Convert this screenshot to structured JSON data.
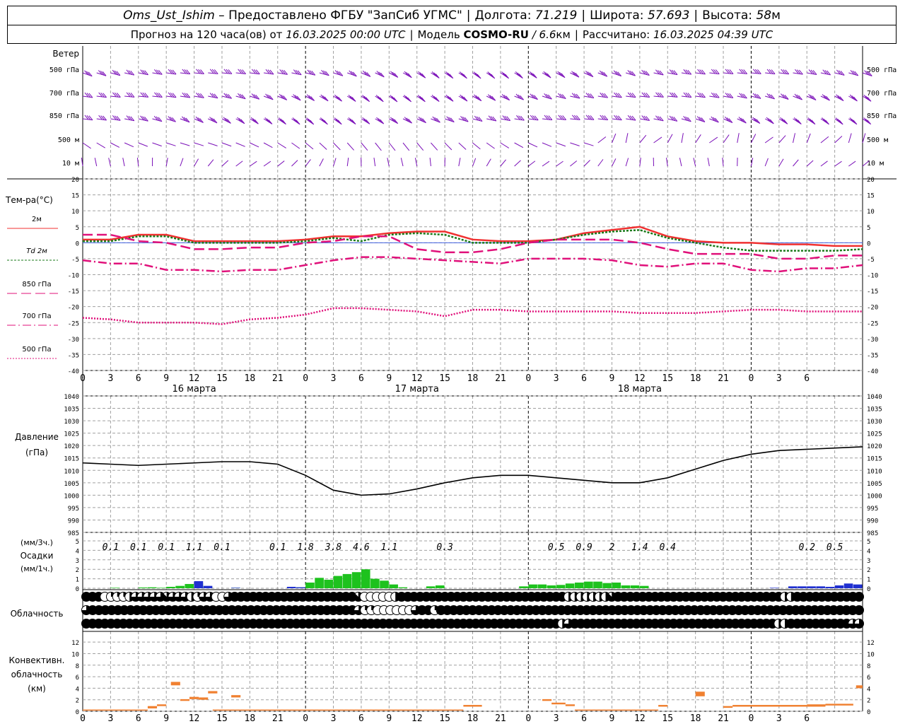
{
  "header": {
    "station": "Oms_Ust_Ishim",
    "provided_by": "– Предоставлено ФГБУ \"ЗапСиб УГМС\"",
    "lon_label": "Долгота:",
    "lon_value": "71.219",
    "lat_label": "Широта:",
    "lat_value": "57.693",
    "alt_label": "Высота:",
    "alt_value": "58",
    "alt_unit": "м",
    "forecast_prefix": "Прогноз на 120 часа(ов) от",
    "forecast_start": "16.03.2025 00:00 UTC",
    "model_label": "Модель",
    "model_name": "COSMO-RU",
    "model_res": "/ 6.6",
    "model_res_unit": "км",
    "computed_label": "Рассчитано:",
    "computed_value": "16.03.2025 04:39 UTC"
  },
  "colors": {
    "wind": "#7a0fb8",
    "t2m": "#f03030",
    "td2m": "#1a7a1a",
    "t850": "#e0107a",
    "t700": "#e0107a",
    "t500": "#e0107a",
    "precip": "#1ec21e",
    "precip_hourly": "#2030d0",
    "conv": "#f08030",
    "grid": "#a0a0a0"
  },
  "x_ticks": [
    "0",
    "3",
    "6",
    "9",
    "12",
    "15",
    "18",
    "21",
    "0",
    "3",
    "6",
    "9",
    "12",
    "15",
    "18",
    "21",
    "0",
    "3",
    "6",
    "9",
    "12",
    "15",
    "18",
    "21",
    "0",
    "3",
    "6"
  ],
  "day_labels": [
    "16 марта",
    "17 марта",
    "18 марта"
  ],
  "wind": {
    "title": "Ветер",
    "levels": [
      "500 гПа",
      "700 гПа",
      "850 гПа",
      "500 м",
      "10 м"
    ]
  },
  "temperature": {
    "title": "Тем-ра(°C)",
    "legend": [
      "2м",
      "Td 2м",
      "850 гПа",
      "700 гПа",
      "500 гПа"
    ],
    "yticks": [
      "20",
      "15",
      "10",
      "5",
      "0",
      "-5",
      "-10",
      "-15",
      "-20",
      "-25",
      "-30",
      "-35",
      "-40"
    ]
  },
  "pressure": {
    "title": "Давление",
    "unit": "(гПа)",
    "yticks": [
      "1040",
      "1035",
      "1030",
      "1025",
      "1020",
      "1015",
      "1010",
      "1005",
      "1000",
      "995",
      "990",
      "985"
    ]
  },
  "precip": {
    "unit3": "(мм/3ч.)",
    "title": "Осадки",
    "unit1": "(мм/1ч.)",
    "yticks": [
      "5",
      "4",
      "3",
      "2",
      "1",
      "0"
    ],
    "labels": [
      {
        "x": 3,
        "text": "0.1"
      },
      {
        "x": 6,
        "text": "0.1"
      },
      {
        "x": 9,
        "text": "0.1"
      },
      {
        "x": 12,
        "text": "1.1"
      },
      {
        "x": 15,
        "text": "0.1"
      },
      {
        "x": 21,
        "text": "0.1"
      },
      {
        "x": 24,
        "text": "1.8"
      },
      {
        "x": 27,
        "text": "3.8"
      },
      {
        "x": 30,
        "text": "4.6"
      },
      {
        "x": 33,
        "text": "1.1"
      },
      {
        "x": 39,
        "text": "0.3"
      },
      {
        "x": 51,
        "text": "0.5"
      },
      {
        "x": 54,
        "text": "0.9"
      },
      {
        "x": 57,
        "text": "2"
      },
      {
        "x": 60,
        "text": "1.4"
      },
      {
        "x": 63,
        "text": "0.4"
      },
      {
        "x": 78,
        "text": "0.2"
      },
      {
        "x": 81,
        "text": "0.5"
      }
    ]
  },
  "clouds": {
    "title": "Облачность"
  },
  "convective": {
    "title1": "Конвективн.",
    "title2": "облачность",
    "unit": "(км)",
    "yticks": [
      "12",
      "10",
      "8",
      "6",
      "4",
      "2",
      "0"
    ]
  },
  "chart_data": [
    {
      "type": "line",
      "name": "temperature",
      "x_hours": [
        0,
        3,
        6,
        9,
        12,
        15,
        18,
        21,
        24,
        27,
        30,
        33,
        36,
        39,
        42,
        45,
        48,
        51,
        54,
        57,
        60,
        63,
        66,
        69,
        72,
        75,
        78,
        81,
        84
      ],
      "series": [
        {
          "name": "2м",
          "values": [
            1,
            1,
            2.5,
            2.5,
            0.5,
            0.5,
            0.5,
            0.5,
            1,
            2,
            2,
            3,
            3.5,
            3.5,
            1,
            0.5,
            0.5,
            1,
            3,
            4,
            5,
            2,
            0.5,
            0,
            0,
            -0.5,
            -0.5,
            -1,
            -1
          ]
        },
        {
          "name": "Td 2м",
          "values": [
            0.5,
            0.5,
            2,
            2,
            0,
            0,
            0,
            0,
            0.5,
            1.5,
            0.5,
            2.5,
            3,
            2.5,
            0,
            0,
            0,
            1,
            2.5,
            3.5,
            4,
            1.5,
            0,
            -1.5,
            -2.5,
            -2.5,
            -2.5,
            -2.5,
            -2
          ]
        },
        {
          "name": "850 гПа",
          "values": [
            2.5,
            2.5,
            0.5,
            0,
            -2,
            -2,
            -1.5,
            -1.5,
            0,
            0.5,
            2,
            2,
            -2,
            -3,
            -3,
            -2,
            0,
            1,
            1,
            1,
            0,
            -2,
            -3.5,
            -3.5,
            -3.5,
            -5,
            -5,
            -4,
            -4
          ]
        },
        {
          "name": "700 гПа",
          "values": [
            -5.5,
            -6.5,
            -6.5,
            -8.5,
            -8.5,
            -9,
            -8.5,
            -8.5,
            -7,
            -5.5,
            -4.5,
            -4.5,
            -5,
            -5.5,
            -6,
            -6.5,
            -5,
            -5,
            -5,
            -5.5,
            -7,
            -7.5,
            -6.5,
            -6.5,
            -8.5,
            -9,
            -8,
            -8,
            -7
          ]
        },
        {
          "name": "500 гПа",
          "values": [
            -23.5,
            -24,
            -25,
            -25,
            -25,
            -25.5,
            -24,
            -23.5,
            -22.5,
            -20.5,
            -20.5,
            -21,
            -21.5,
            -23,
            -21,
            -21,
            -21.5,
            -21.5,
            -21.5,
            -21.5,
            -22,
            -22,
            -22,
            -21.5,
            -21,
            -21,
            -21.5,
            -21.5,
            -21.5
          ]
        }
      ],
      "ylim": [
        -40,
        20
      ]
    },
    {
      "type": "line",
      "name": "pressure",
      "x_hours": [
        0,
        3,
        6,
        9,
        12,
        15,
        18,
        21,
        24,
        27,
        30,
        33,
        36,
        39,
        42,
        45,
        48,
        51,
        54,
        57,
        60,
        63,
        66,
        69,
        72,
        75,
        78,
        81,
        84
      ],
      "values": [
        1013,
        1012.5,
        1012,
        1012.5,
        1013,
        1013.5,
        1013.5,
        1012.5,
        1008,
        1002,
        1000,
        1000.5,
        1002.5,
        1005,
        1007,
        1008,
        1008,
        1007,
        1006,
        1005,
        1005,
        1007,
        1010.5,
        1014,
        1016.5,
        1018,
        1018.5,
        1019,
        1019.5
      ],
      "ylim": [
        985,
        1040
      ]
    },
    {
      "type": "bar",
      "name": "precipitation",
      "x_hours": [
        0,
        1,
        2,
        3,
        4,
        5,
        6,
        7,
        8,
        9,
        10,
        11,
        12,
        13,
        14,
        15,
        16,
        17,
        18,
        19,
        20,
        21,
        22,
        23,
        24,
        25,
        26,
        27,
        28,
        29,
        30,
        31,
        32,
        33,
        34,
        35,
        36,
        37,
        38,
        39,
        40,
        41,
        42,
        43,
        44,
        45,
        46,
        47,
        48,
        49,
        50,
        51,
        52,
        53,
        54,
        55,
        56,
        57,
        58,
        59,
        60,
        61,
        62,
        63,
        64,
        65,
        66,
        67,
        68,
        69,
        70,
        71,
        72,
        73,
        74,
        75,
        76,
        77,
        78,
        79,
        80,
        81,
        82,
        83
      ],
      "series": [
        {
          "name": "3h",
          "values": [
            0,
            0,
            0,
            0.05,
            0,
            0,
            0.08,
            0.1,
            0.05,
            0.15,
            0.25,
            0.45,
            0.55,
            0.1,
            0,
            0,
            0.05,
            0,
            0,
            0,
            0,
            0,
            0,
            0.1,
            0.6,
            1.1,
            0.9,
            1.3,
            1.5,
            1.7,
            2.0,
            1.0,
            0.8,
            0.4,
            0.1,
            0,
            0,
            0.2,
            0.3,
            0,
            0,
            0,
            0,
            0,
            0,
            0,
            0,
            0.2,
            0.4,
            0.4,
            0.3,
            0.35,
            0.5,
            0.6,
            0.7,
            0.7,
            0.55,
            0.6,
            0.3,
            0.3,
            0.25,
            0,
            0,
            0,
            0,
            0,
            0,
            0,
            0,
            0,
            0,
            0,
            0,
            0,
            0,
            0,
            0,
            0,
            0,
            0,
            0,
            0,
            0,
            0
          ]
        },
        {
          "name": "1h",
          "values": [
            0,
            0,
            0,
            0,
            0,
            0,
            0,
            0,
            0,
            0,
            0,
            0,
            0.75,
            0.25,
            0,
            0,
            0.05,
            0,
            0,
            0,
            0,
            0,
            0.15,
            0.1,
            0,
            0,
            0,
            0,
            0,
            0,
            0,
            0,
            0,
            0,
            0,
            0,
            0,
            0,
            0,
            0,
            0,
            0,
            0,
            0,
            0,
            0,
            0,
            0,
            0,
            0,
            0,
            0,
            0,
            0,
            0,
            0,
            0,
            0,
            0,
            0,
            0,
            0,
            0,
            0,
            0,
            0,
            0,
            0,
            0,
            0,
            0,
            0,
            0,
            0,
            0.05,
            0,
            0.2,
            0.2,
            0.2,
            0.2,
            0.15,
            0.3,
            0.5,
            0.4
          ]
        }
      ],
      "ylim": [
        0,
        5
      ]
    },
    {
      "type": "table",
      "name": "cloudiness_octas",
      "rows": [
        [
          8,
          8,
          8,
          0,
          2,
          2,
          2,
          4,
          6,
          6,
          6,
          6,
          6,
          7,
          6,
          6,
          6,
          4,
          2,
          6,
          6,
          0,
          0,
          6,
          8,
          8,
          8,
          8,
          8,
          8,
          8,
          8,
          8,
          8,
          8,
          8,
          8,
          8,
          8,
          8,
          8,
          8,
          8,
          8,
          7,
          0,
          0,
          0,
          0,
          0,
          4,
          8,
          8,
          8,
          8,
          8,
          8,
          8,
          8,
          8,
          8,
          8,
          8,
          8,
          8,
          8,
          8,
          8,
          8,
          8,
          8,
          8,
          8,
          8,
          8,
          8,
          8,
          8,
          4,
          4,
          4,
          4,
          4,
          4,
          4,
          7,
          8,
          8,
          8,
          8,
          8,
          8,
          8,
          8,
          8,
          8,
          8,
          8,
          8,
          8,
          8,
          8,
          8,
          8,
          8,
          8,
          8,
          8,
          8,
          8,
          8,
          8,
          8,
          4,
          4,
          8,
          8,
          8,
          8,
          8,
          8,
          8,
          8,
          8,
          8,
          8
        ],
        [
          6,
          8,
          8,
          8,
          8,
          8,
          8,
          8,
          8,
          8,
          8,
          8,
          8,
          8,
          8,
          8,
          8,
          8,
          8,
          8,
          8,
          8,
          8,
          8,
          8,
          8,
          8,
          8,
          8,
          8,
          8,
          8,
          8,
          8,
          8,
          8,
          8,
          8,
          8,
          8,
          8,
          8,
          8,
          6,
          2,
          2,
          0,
          0,
          0,
          0,
          0,
          0,
          6,
          8,
          8,
          2,
          8,
          8,
          8,
          8,
          8,
          8,
          8,
          8,
          8,
          8,
          8,
          8,
          8,
          8,
          8,
          8,
          8,
          8,
          8,
          8,
          8,
          8,
          8,
          8,
          8,
          8,
          8,
          8,
          8,
          8,
          8,
          8,
          8,
          8,
          8,
          8,
          8,
          8,
          8,
          8,
          8,
          8,
          8,
          8,
          8,
          8,
          8,
          8,
          8,
          8,
          8,
          8,
          8,
          8,
          8,
          8,
          8,
          8,
          8,
          8,
          8,
          8,
          8,
          8,
          8,
          8,
          8
        ],
        [
          8,
          8,
          8,
          8,
          8,
          8,
          8,
          8,
          8,
          8,
          8,
          8,
          8,
          8,
          8,
          8,
          8,
          8,
          8,
          8,
          8,
          8,
          8,
          8,
          8,
          8,
          8,
          8,
          8,
          8,
          8,
          8,
          8,
          8,
          8,
          8,
          8,
          8,
          8,
          8,
          8,
          8,
          8,
          8,
          8,
          8,
          8,
          8,
          8,
          8,
          8,
          8,
          8,
          8,
          8,
          8,
          8,
          8,
          8,
          8,
          8,
          8,
          8,
          8,
          8,
          8,
          8,
          8,
          8,
          8,
          8,
          8,
          8,
          8,
          8,
          8,
          8,
          4,
          6,
          8,
          8,
          8,
          8,
          8,
          8,
          8,
          8,
          8,
          8,
          8,
          8,
          8,
          8,
          8,
          8,
          8,
          8,
          8,
          8,
          8,
          8,
          8,
          8,
          8,
          8,
          8,
          8,
          8,
          8,
          8,
          8,
          8,
          4,
          4,
          8,
          8,
          8,
          8,
          8,
          8,
          8,
          8,
          8,
          8,
          6,
          6
        ]
      ]
    },
    {
      "type": "bar",
      "name": "convective_cloud_km",
      "segments": [
        {
          "x0": 0,
          "x1": 7,
          "y0": 0.2,
          "y1": 0.3
        },
        {
          "x0": 7,
          "x1": 8,
          "y0": 0.5,
          "y1": 0.9
        },
        {
          "x0": 8,
          "x1": 9,
          "y0": 0.9,
          "y1": 1.2
        },
        {
          "x0": 9.5,
          "x1": 10.5,
          "y0": 4.5,
          "y1": 5.1
        },
        {
          "x0": 10.5,
          "x1": 11.5,
          "y0": 1.8,
          "y1": 2.1
        },
        {
          "x0": 11.5,
          "x1": 12.5,
          "y0": 2.1,
          "y1": 2.5
        },
        {
          "x0": 12.5,
          "x1": 13.5,
          "y0": 2.0,
          "y1": 2.4
        },
        {
          "x0": 13.5,
          "x1": 14.5,
          "y0": 3.1,
          "y1": 3.5
        },
        {
          "x0": 16,
          "x1": 17,
          "y0": 2.4,
          "y1": 2.8
        },
        {
          "x0": 14,
          "x1": 41,
          "y0": 0.2,
          "y1": 0.3
        },
        {
          "x0": 41,
          "x1": 43,
          "y0": 0.8,
          "y1": 1.1
        },
        {
          "x0": 49.5,
          "x1": 50.5,
          "y0": 1.8,
          "y1": 2.1
        },
        {
          "x0": 50.5,
          "x1": 52,
          "y0": 1.2,
          "y1": 1.5
        },
        {
          "x0": 52,
          "x1": 53,
          "y0": 0.9,
          "y1": 1.2
        },
        {
          "x0": 53,
          "x1": 62,
          "y0": 0.2,
          "y1": 0.3
        },
        {
          "x0": 62,
          "x1": 63,
          "y0": 0.8,
          "y1": 1.1
        },
        {
          "x0": 66,
          "x1": 67,
          "y0": 2.6,
          "y1": 3.4
        },
        {
          "x0": 69,
          "x1": 70,
          "y0": 0.6,
          "y1": 0.9
        },
        {
          "x0": 70,
          "x1": 78,
          "y0": 0.8,
          "y1": 1.1
        },
        {
          "x0": 78,
          "x1": 80,
          "y0": 0.8,
          "y1": 1.2
        },
        {
          "x0": 80,
          "x1": 83,
          "y0": 1.0,
          "y1": 1.3
        },
        {
          "x0": 83.3,
          "x1": 84,
          "y0": 4.0,
          "y1": 4.5
        }
      ],
      "ylim": [
        0,
        13
      ]
    }
  ]
}
